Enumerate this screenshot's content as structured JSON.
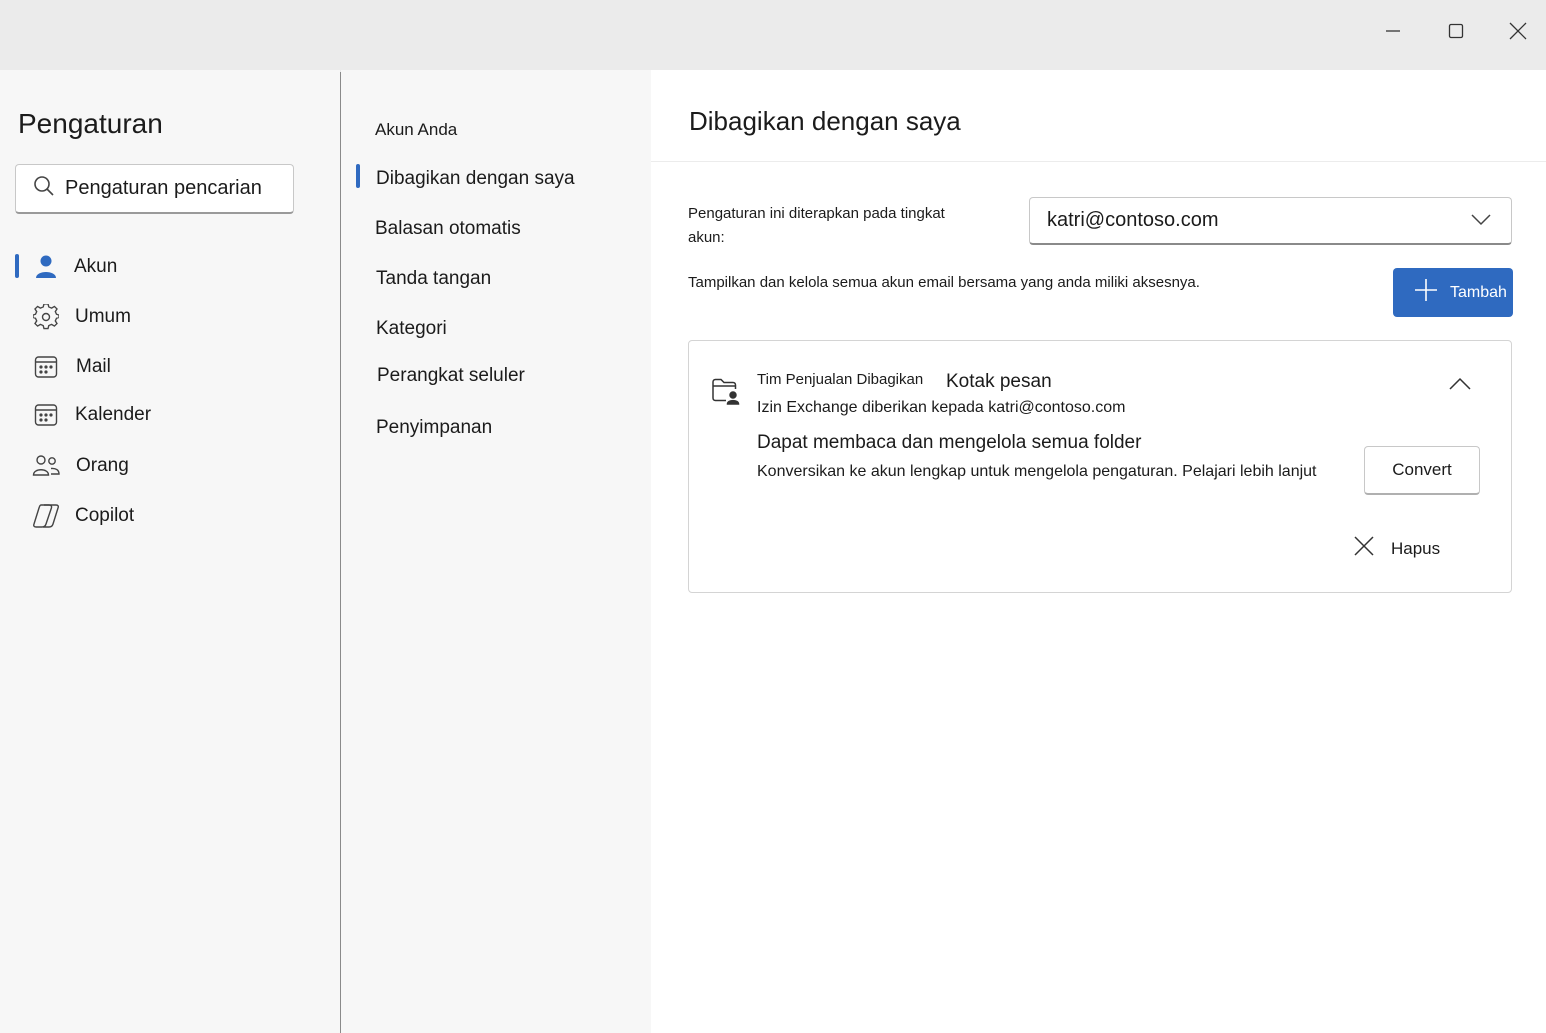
{
  "window": {
    "minimize_icon": "minimize-icon",
    "maximize_icon": "maximize-icon",
    "close_icon": "close-icon"
  },
  "sidebar": {
    "title": "Pengaturan",
    "search_placeholder": "Pengaturan pencarian",
    "items": [
      {
        "label": "Akun",
        "icon": "person-icon",
        "selected": true
      },
      {
        "label": "Umum",
        "icon": "gear-icon"
      },
      {
        "label": "Mail",
        "icon": "mail-icon"
      },
      {
        "label": "Kalender",
        "icon": "calendar-icon"
      },
      {
        "label": "Orang",
        "icon": "people-icon"
      },
      {
        "label": "Copilot",
        "icon": "copilot-icon"
      }
    ]
  },
  "subnav": {
    "items": [
      {
        "label": "Akun Anda"
      },
      {
        "label": "Dibagikan dengan saya",
        "selected": true
      },
      {
        "label": "Balasan otomatis"
      },
      {
        "label": "Tanda tangan"
      },
      {
        "label": "Kategori"
      },
      {
        "label": "Perangkat seluler"
      },
      {
        "label": "Penyimpanan"
      }
    ]
  },
  "main": {
    "title": "Dibagikan dengan saya",
    "apply_label": "Pengaturan ini diterapkan pada tingkat akun:",
    "account_value": "katri@contoso.com",
    "description": "Tampilkan dan kelola semua akun email bersama yang anda miliki aksesnya.",
    "add_button": "Tambah",
    "card": {
      "mailbox_name": "Tim Penjualan Dibagikan",
      "mailbox_type": "Kotak pesan",
      "permission_line": "Izin Exchange diberikan kepada katri@contoso.com",
      "permission_title": "Dapat membaca dan mengelola semua folder",
      "permission_desc": "Konversikan ke akun lengkap untuk mengelola pengaturan. Pelajari lebih lanjut",
      "convert_button": "Convert",
      "remove_label": "Hapus"
    }
  },
  "colors": {
    "accent": "#2f6ac0",
    "sidebar_bg": "#f7f7f7",
    "titlebar_bg": "#ebebeb"
  }
}
